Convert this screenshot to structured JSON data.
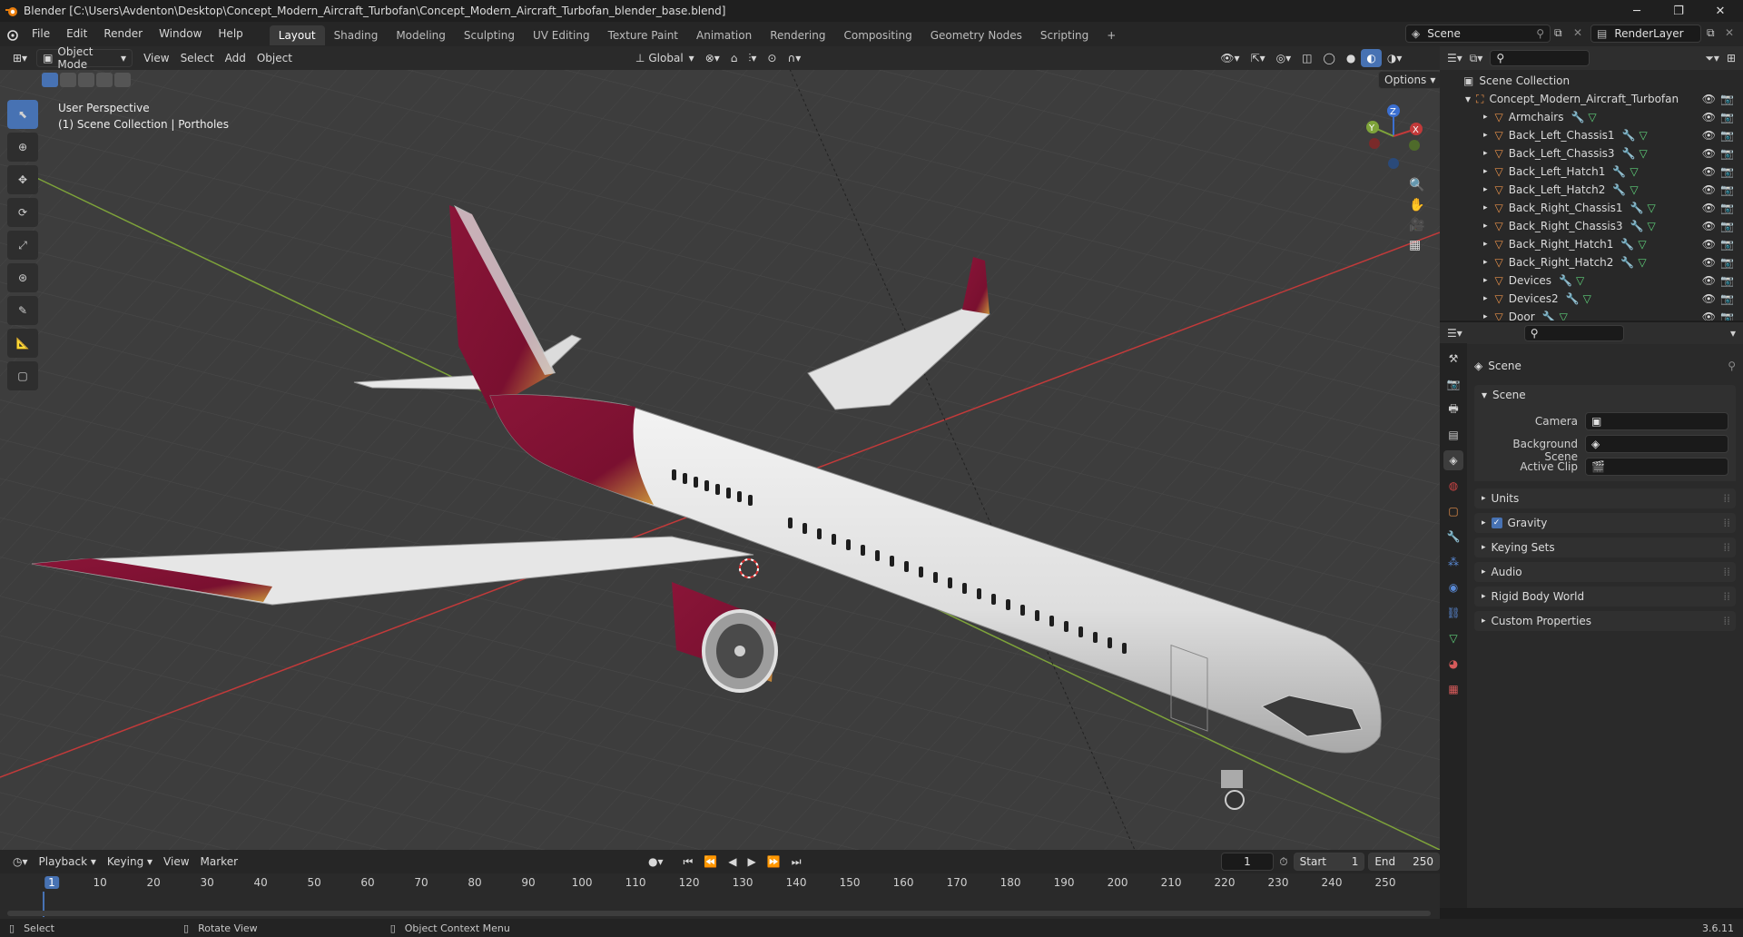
{
  "window": {
    "title": "Blender [C:\\Users\\Avdenton\\Desktop\\Concept_Modern_Aircraft_Turbofan\\Concept_Modern_Aircraft_Turbofan_blender_base.blend]",
    "version": "3.6.11"
  },
  "menu": [
    "File",
    "Edit",
    "Render",
    "Window",
    "Help"
  ],
  "workspaces": [
    {
      "label": "Layout",
      "active": true
    },
    {
      "label": "Shading"
    },
    {
      "label": "Modeling"
    },
    {
      "label": "Sculpting"
    },
    {
      "label": "UV Editing"
    },
    {
      "label": "Texture Paint"
    },
    {
      "label": "Animation"
    },
    {
      "label": "Rendering"
    },
    {
      "label": "Compositing"
    },
    {
      "label": "Geometry Nodes"
    },
    {
      "label": "Scripting"
    }
  ],
  "scene_field": "Scene",
  "view_layer_field": "RenderLayer",
  "viewport": {
    "mode": "Object Mode",
    "menus": [
      "View",
      "Select",
      "Add",
      "Object"
    ],
    "transform_orientation": "Global",
    "options_label": "Options",
    "overlay_title": "User Perspective",
    "overlay_subtitle": "(1) Scene Collection | Portholes",
    "gizmo_axes": {
      "x": "X",
      "y": "Y",
      "z": "Z"
    }
  },
  "outliner": {
    "root": "Scene Collection",
    "collection": "Concept_Modern_Aircraft_Turbofan",
    "items": [
      "Armchairs",
      "Back_Left_Chassis1",
      "Back_Left_Chassis3",
      "Back_Left_Hatch1",
      "Back_Left_Hatch2",
      "Back_Right_Chassis1",
      "Back_Right_Chassis3",
      "Back_Right_Hatch1",
      "Back_Right_Hatch2",
      "Devices",
      "Devices2",
      "Door"
    ]
  },
  "properties": {
    "header": "Scene",
    "section": "Scene",
    "fields": [
      {
        "label": "Camera"
      },
      {
        "label": "Background Scene"
      },
      {
        "label": "Active Clip"
      }
    ],
    "panels": [
      "Units",
      "Gravity",
      "Keying Sets",
      "Audio",
      "Rigid Body World",
      "Custom Properties"
    ],
    "gravity_checked": true
  },
  "timeline": {
    "menus": [
      "Playback",
      "Keying",
      "View",
      "Marker"
    ],
    "current_frame": "1",
    "start_label": "Start",
    "start_value": "1",
    "end_label": "End",
    "end_value": "250",
    "ticks": [
      "1",
      "10",
      "20",
      "30",
      "40",
      "50",
      "60",
      "70",
      "80",
      "90",
      "100",
      "110",
      "120",
      "130",
      "140",
      "150",
      "160",
      "170",
      "180",
      "190",
      "200",
      "210",
      "220",
      "230",
      "240",
      "250"
    ]
  },
  "status": {
    "select": "Select",
    "rotate": "Rotate View",
    "context": "Object Context Menu"
  },
  "colors": {
    "accent": "#4772b3",
    "livery": "#8a1538",
    "livery_gold": "#c9933a",
    "axis_x": "#c23a3a",
    "axis_y": "#7ea33a"
  }
}
